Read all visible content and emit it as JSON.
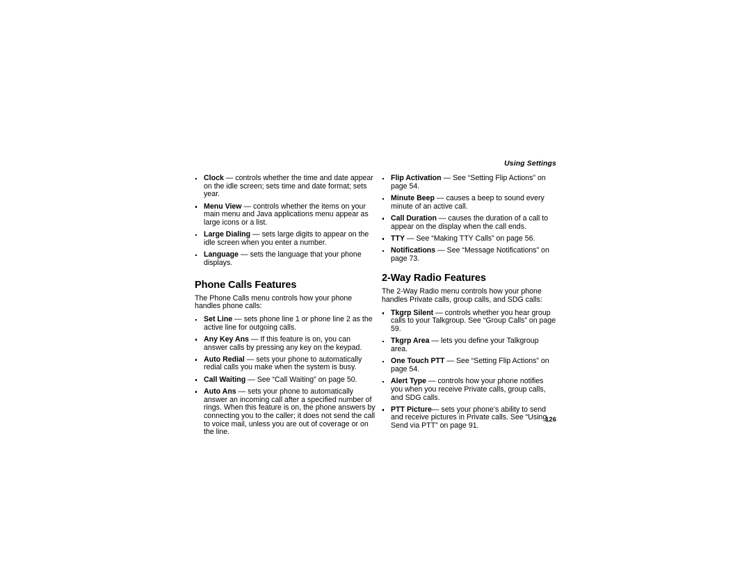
{
  "running_head": "Using Settings",
  "folio": "126",
  "left_column": {
    "top_bullets": [
      {
        "term": "Clock",
        "body": " — controls whether the time and date appear on the idle screen; sets time and date format; sets year."
      },
      {
        "term": "Menu View",
        "body": " — controls whether the items on your main menu and Java applications menu appear as large icons or a list."
      },
      {
        "term": "Large Dialing",
        "body": " — sets large digits to appear on the idle screen when you enter a number."
      },
      {
        "term": "Language",
        "body": " — sets the language that your phone displays."
      }
    ],
    "section": {
      "heading": "Phone Calls Features",
      "intro": "The Phone Calls menu controls how your phone handles phone calls:",
      "bullets": [
        {
          "term": "Set Line",
          "body": " — sets phone line 1 or phone line 2 as the active line for outgoing calls."
        },
        {
          "term": "Any Key Ans",
          "body": " — If this feature is on, you can answer calls by pressing any key on the keypad."
        },
        {
          "term": "Auto Redial",
          "body": " — sets your phone to automatically redial calls you make when the system is busy."
        },
        {
          "term": "Call Waiting",
          "body": " — See “Call Waiting” on page 50."
        },
        {
          "term": "Auto Ans",
          "body": " — sets your phone to automatically answer an incoming call after a specified number of rings. When this feature is on, the phone answers by connecting you to the caller; it does not send the call to voice mail, unless you are out of coverage or on the line."
        }
      ]
    }
  },
  "right_column": {
    "top_bullets": [
      {
        "term": "Flip Activation",
        "body": " — See “Setting Flip Actions” on page 54."
      },
      {
        "term": "Minute Beep",
        "body": " — causes a beep to sound every minute of an active call."
      },
      {
        "term": "Call Duration",
        "body": " — causes the duration of a call to appear on the display when the call ends."
      },
      {
        "term": "TTY",
        "body": " — See “Making TTY Calls” on page 56."
      },
      {
        "term": "Notifications",
        "body": " — See “Message Notifications” on page 73."
      }
    ],
    "section": {
      "heading": "2-Way Radio Features",
      "intro": "The 2-Way Radio menu controls how your phone handles Private calls, group calls, and SDG calls:",
      "bullets": [
        {
          "term": "Tkgrp Silent",
          "body": " — controls whether you hear group calls to your Talkgroup. See “Group Calls” on page 59."
        },
        {
          "term": "Tkgrp Area",
          "body": " — lets you define your Talkgroup area."
        },
        {
          "term": "One Touch PTT",
          "body": " — See “Setting Flip Actions” on page 54."
        },
        {
          "term": "Alert Type",
          "body": " — controls how your phone notifies you when you receive Private calls, group calls, and SDG calls."
        },
        {
          "term": "PTT Picture",
          "body": "— sets your phone’s ability to send and receive pictures in Private calls. See “Using Send via PTT” on page 91."
        }
      ]
    }
  }
}
